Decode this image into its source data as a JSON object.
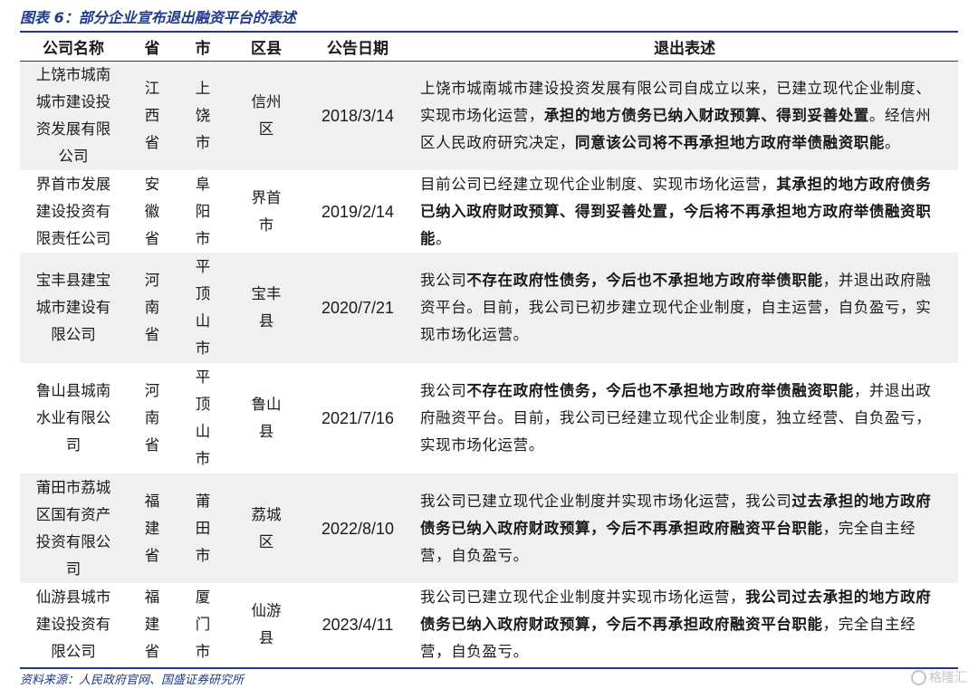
{
  "figure": {
    "title": "图表 6：部分企业宣布退出融资平台的表述"
  },
  "table": {
    "headers": [
      "公司名称",
      "省",
      "市",
      "区县",
      "公告日期",
      "退出表述"
    ],
    "rows": [
      {
        "company_lines": [
          "上饶市城南",
          "城市建设投",
          "资发展有限",
          "公司"
        ],
        "province": "江西省",
        "city": "上饶市",
        "district": "信州区",
        "date": "2018/3/14",
        "desc": [
          {
            "t": "上饶市城南城市建设投资发展有限公司自成立以来，已建立现代企业制度、实现市场化运营，",
            "b": false
          },
          {
            "t": "承担的地方债务已纳入财政预算、得到妥善处置",
            "b": true
          },
          {
            "t": "。经信州区人民政府研究决定，",
            "b": false
          },
          {
            "t": "同意该公司将不再承担地方政府举债融资职能",
            "b": true
          },
          {
            "t": "。",
            "b": false
          }
        ]
      },
      {
        "company_lines": [
          "界首市发展",
          "建设投资有",
          "限责任公司"
        ],
        "province": "安徽省",
        "city": "阜阳市",
        "district": "界首市",
        "date": "2019/2/14",
        "desc": [
          {
            "t": "目前公司已经建立现代企业制度、实现市场化运营，",
            "b": false
          },
          {
            "t": "其承担的地方政府债务已纳入政府财政预算、得到妥善处置，今后将不再承担地方政府举债融资职能",
            "b": true
          },
          {
            "t": "。",
            "b": false
          }
        ]
      },
      {
        "company_lines": [
          "宝丰县建宝",
          "城市建设有",
          "限公司"
        ],
        "province": "河南省",
        "city": "平顶山市",
        "district": "宝丰县",
        "date": "2020/7/21",
        "desc": [
          {
            "t": "我公司",
            "b": false
          },
          {
            "t": "不存在政府性债务，今后也不承担地方政府举债职能",
            "b": true
          },
          {
            "t": "，并退出政府融资平台。目前，我公司已初步建立现代企业制度，自主运营，自负盈亏，实现市场化运营。",
            "b": false
          }
        ]
      },
      {
        "company_lines": [
          "鲁山县城南",
          "水业有限公",
          "司"
        ],
        "province": "河南省",
        "city": "平顶山市",
        "district": "鲁山县",
        "date": "2021/7/16",
        "desc": [
          {
            "t": "我公司",
            "b": false
          },
          {
            "t": "不存在政府性债务，今后也不承担地方政府举债融资职能",
            "b": true
          },
          {
            "t": "，并退出政府融资平台。目前，我公司已经建立现代企业制度，独立经营、自负盈亏，实现市场化运营。",
            "b": false
          }
        ]
      },
      {
        "company_lines": [
          "莆田市荔城",
          "区国有资产",
          "投资有限公",
          "司"
        ],
        "province": "福建省",
        "city": "莆田市",
        "district": "荔城区",
        "date": "2022/8/10",
        "desc": [
          {
            "t": "我公司已建立现代企业制度并实现市场化运营，我公司",
            "b": false
          },
          {
            "t": "过去承担的地方政府债务已纳入政府财政预算，今后不再承担政府融资平台职能",
            "b": true
          },
          {
            "t": "，完全自主经营，自负盈亏。",
            "b": false
          }
        ]
      },
      {
        "company_lines": [
          "仙游县城市",
          "建设投资有",
          "限公司"
        ],
        "province": "福建省",
        "city": "厦门市",
        "district": "仙游县",
        "date": "2023/4/11",
        "desc": [
          {
            "t": "我公司已建立现代企业制度并实现市场化运营，",
            "b": false
          },
          {
            "t": "我公司过去承担的地方政府债务已纳入政府财政预算，今后不再承担政府融资平台职能",
            "b": true
          },
          {
            "t": "，完全自主经营，自负盈亏。",
            "b": false
          }
        ]
      }
    ]
  },
  "source": "资料来源：人民政府官网、国盛证券研究所",
  "watermark": "格隆汇"
}
